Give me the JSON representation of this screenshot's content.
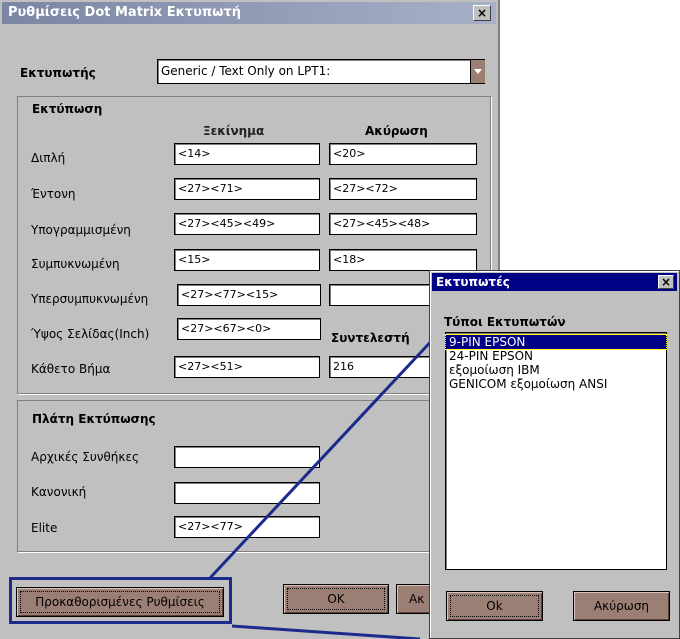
{
  "main_dialog": {
    "title": "Ρυθμίσεις Dot Matrix Εκτυπωτή",
    "close_symbol": "×",
    "printer_label": "Εκτυπωτής",
    "printer_value": "Generic / Text Only on LPT1:",
    "print_group": {
      "title": "Εκτύπωση",
      "col_start": "Ξεκίνημα",
      "col_cancel": "Ακύρωση",
      "col_factor": "Συντελεστή",
      "rows": [
        {
          "label": "Διπλή",
          "start": "<14>",
          "cancel": "<20>"
        },
        {
          "label": "Έντονη",
          "start": "<27><71>",
          "cancel": "<27><72>"
        },
        {
          "label": "Υπογραμμισμένη",
          "start": "<27><45><49>",
          "cancel": "<27><45><48>"
        },
        {
          "label": "Συμπυκνωμένη",
          "start": "<15>",
          "cancel": "<18>"
        },
        {
          "label": "Υπερσυμπυκνωμένη",
          "start": "<27><77><15>",
          "cancel": ""
        },
        {
          "label": "Ύψος Σελίδας(Inch)",
          "start": "<27><67><0>",
          "cancel": ""
        },
        {
          "label": "Κάθετο Βήμα",
          "start": "<27><51>",
          "cancel": "216"
        }
      ]
    },
    "width_group": {
      "title": "Πλάτη Εκτύπωσης",
      "rows": [
        {
          "label": "Αρχικές Συνθήκες",
          "value": ""
        },
        {
          "label": "Κανονική",
          "value": ""
        },
        {
          "label": "Elite",
          "value": "<27><77>"
        }
      ]
    },
    "defaults_button": "Προκαθορισμένες Ρυθμίσεις",
    "ok_button": "OK",
    "cancel_button_partial": "Ακ"
  },
  "printers_dialog": {
    "title": "Εκτυπωτές",
    "close_symbol": "×",
    "list_label": "Τύποι Εκτυπωτών",
    "items": [
      "9-PIN EPSON",
      "24-PIN EPSON",
      "εξομοίωση IBM",
      "GENICOM εξομοίωση ANSI"
    ],
    "selected_index": 0,
    "ok_button": "Ok",
    "cancel_button": "Ακύρωση"
  },
  "colors": {
    "title_active": "#000084",
    "title_inactive": "#7b86a4",
    "highlight_frame": "#1c2a8c",
    "button_face": "#9c7f74",
    "dialog_face": "#c0c0c0"
  }
}
